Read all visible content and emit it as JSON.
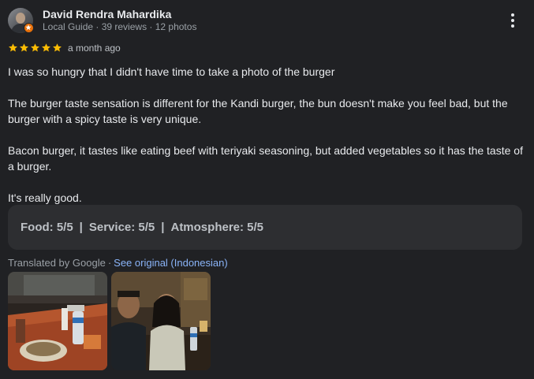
{
  "review": {
    "author_name": "David Rendra Mahardika",
    "author_meta": "Local Guide · 39 reviews · 12 photos",
    "rating_stars": 5,
    "time_ago": "a month ago",
    "paragraphs": [
      "I was so hungry that I didn't have time to take a photo of the burger",
      "The burger taste sensation is different for the Kandi burger, the bun doesn't make you feel bad, but the burger with a spicy taste is very unique.",
      "Bacon burger, it tastes like eating beef with teriyaki seasoning, but added vegetables so it has the taste of a burger.",
      "It's really good."
    ],
    "ratings": {
      "food": "Food: 5/5",
      "separator": "|",
      "service": "Service: 5/5",
      "atmosphere": "Atmosphere: 5/5"
    },
    "translated_by": "Translated by Google",
    "translated_dot": "·",
    "see_original": "See original (Indonesian)"
  },
  "colors": {
    "background": "#202124",
    "star": "#fbbc04",
    "link": "#8ab4f8",
    "badge": "#e8710a"
  },
  "icons": {
    "menu": "more-vert-icon",
    "badge": "local-guide-badge-icon",
    "star": "star-icon"
  }
}
